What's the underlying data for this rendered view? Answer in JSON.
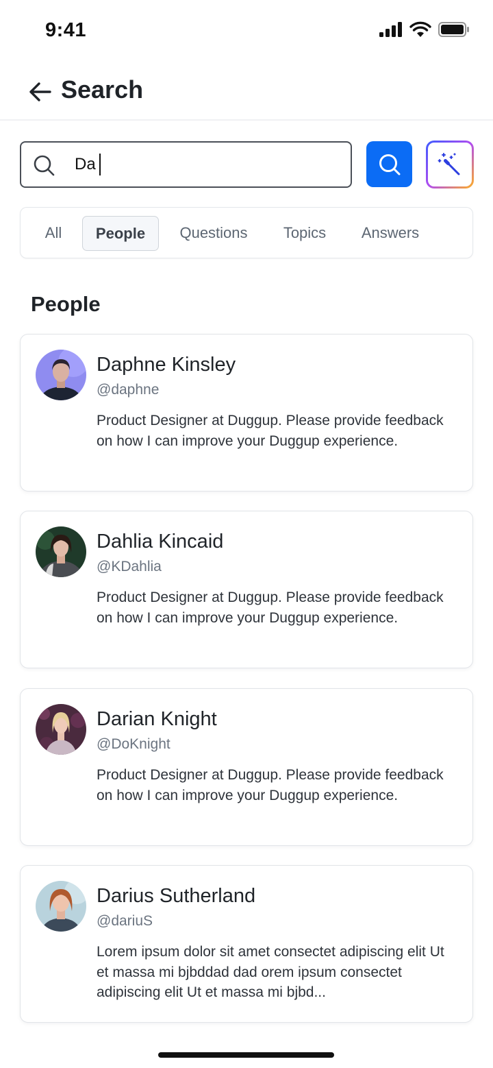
{
  "status_bar": {
    "time": "9:41"
  },
  "header": {
    "title": "Search"
  },
  "search": {
    "value": "Da"
  },
  "tabs": [
    {
      "label": "All",
      "active": false
    },
    {
      "label": "People",
      "active": true
    },
    {
      "label": "Questions",
      "active": false
    },
    {
      "label": "Topics",
      "active": false
    },
    {
      "label": "Answers",
      "active": false
    }
  ],
  "section": {
    "title": "People"
  },
  "people": [
    {
      "name": "Daphne Kinsley",
      "handle": "@daphne",
      "bio": "Product Designer at Duggup. Please provide feedback on how I can improve your Duggup experience."
    },
    {
      "name": "Dahlia Kincaid",
      "handle": "@KDahlia",
      "bio": "Product Designer at Duggup. Please provide feedback on how I can improve your Duggup experience."
    },
    {
      "name": "Darian Knight",
      "handle": "@DoKnight",
      "bio": "Product Designer at Duggup. Please provide feedback on how I can improve your Duggup experience."
    },
    {
      "name": "Darius Sutherland",
      "handle": "@dariuS",
      "bio": "Lorem ipsum dolor sit amet consectet adipiscing elit Ut et massa mi bjbddad dad orem ipsum consectet adipiscing elit Ut et massa mi bjbd..."
    }
  ],
  "colors": {
    "primary": "#0b6cf5",
    "text": "#1f2328",
    "muted": "#6b7480",
    "border": "#e1e4e8"
  },
  "icons": {
    "back": "arrow-left-icon",
    "search": "search-icon",
    "search_button": "search-icon",
    "magic": "magic-wand-icon",
    "signal": "cellular-signal-icon",
    "wifi": "wifi-icon",
    "battery": "battery-icon"
  }
}
